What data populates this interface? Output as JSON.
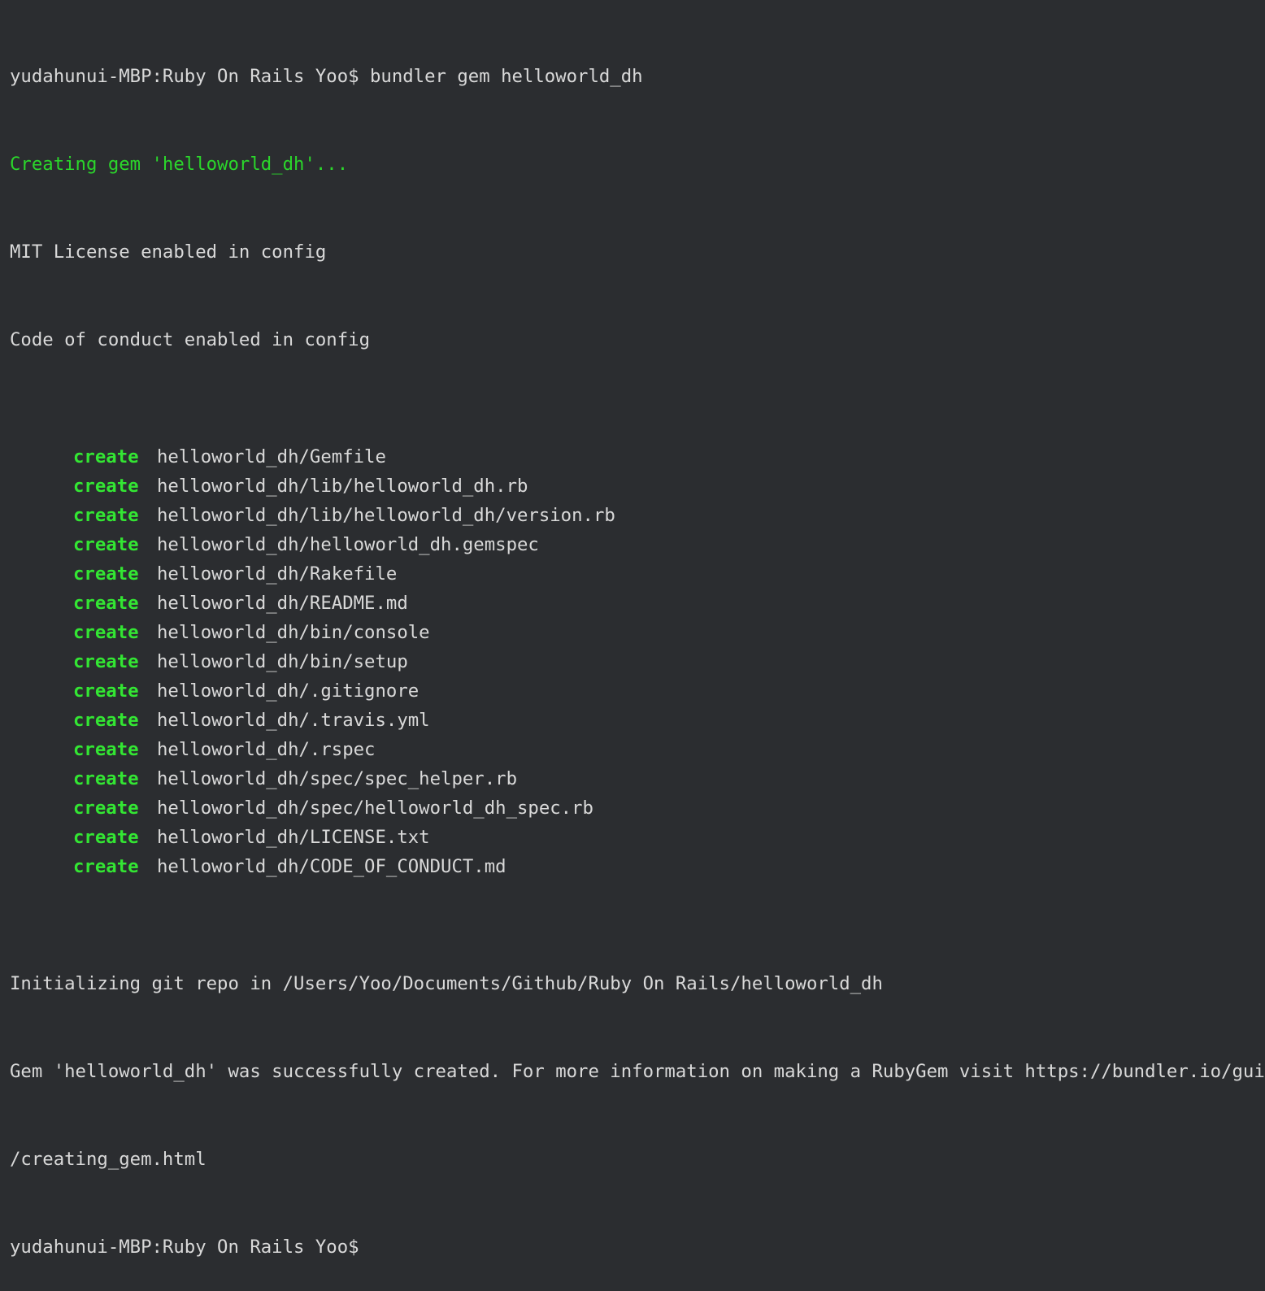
{
  "terminal": {
    "prompt_command": "yudahunui-MBP:Ruby On Rails Yoo$ bundler gem helloworld_dh",
    "creating_line": "Creating gem 'helloworld_dh'...",
    "mit_line": "MIT License enabled in config",
    "coc_line": "Code of conduct enabled in config",
    "create_label": "create",
    "created_files": [
      "helloworld_dh/Gemfile",
      "helloworld_dh/lib/helloworld_dh.rb",
      "helloworld_dh/lib/helloworld_dh/version.rb",
      "helloworld_dh/helloworld_dh.gemspec",
      "helloworld_dh/Rakefile",
      "helloworld_dh/README.md",
      "helloworld_dh/bin/console",
      "helloworld_dh/bin/setup",
      "helloworld_dh/.gitignore",
      "helloworld_dh/.travis.yml",
      "helloworld_dh/.rspec",
      "helloworld_dh/spec/spec_helper.rb",
      "helloworld_dh/spec/helloworld_dh_spec.rb",
      "helloworld_dh/LICENSE.txt",
      "helloworld_dh/CODE_OF_CONDUCT.md"
    ],
    "git_init_line": "Initializing git repo in /Users/Yoo/Documents/Github/Ruby On Rails/helloworld_dh",
    "success_line_1": "Gem 'helloworld_dh' was successfully created. For more information on making a RubyGem visit https://bundler.io/guides",
    "success_line_2": "/creating_gem.html",
    "final_prompt": "yudahunui-MBP:Ruby On Rails Yoo$"
  },
  "colors": {
    "background": "#2b2d30",
    "text": "#d9d9d9",
    "green": "#2bd62b",
    "create_green": "#33e633"
  }
}
